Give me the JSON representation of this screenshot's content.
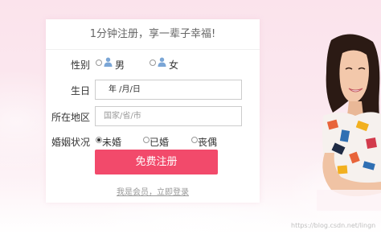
{
  "form": {
    "title": "1分钟注册，享一辈子幸福!",
    "gender": {
      "label": "性别",
      "options": [
        "男",
        "女"
      ]
    },
    "birthday": {
      "label": "生日",
      "value": "年 /月/日"
    },
    "region": {
      "label": "所在地区",
      "placeholder": "国家/省/市"
    },
    "marital": {
      "label": "婚姻状况",
      "options": [
        "未婚",
        "已婚",
        "丧偶"
      ],
      "selected": "未婚"
    },
    "submit_label": "免费注册",
    "login_link": "我是会员，立即登录"
  },
  "watermark": "https://blog.csdn.net/lingn",
  "colors": {
    "accent": "#f24a6b",
    "background": "#fbe3ec"
  }
}
